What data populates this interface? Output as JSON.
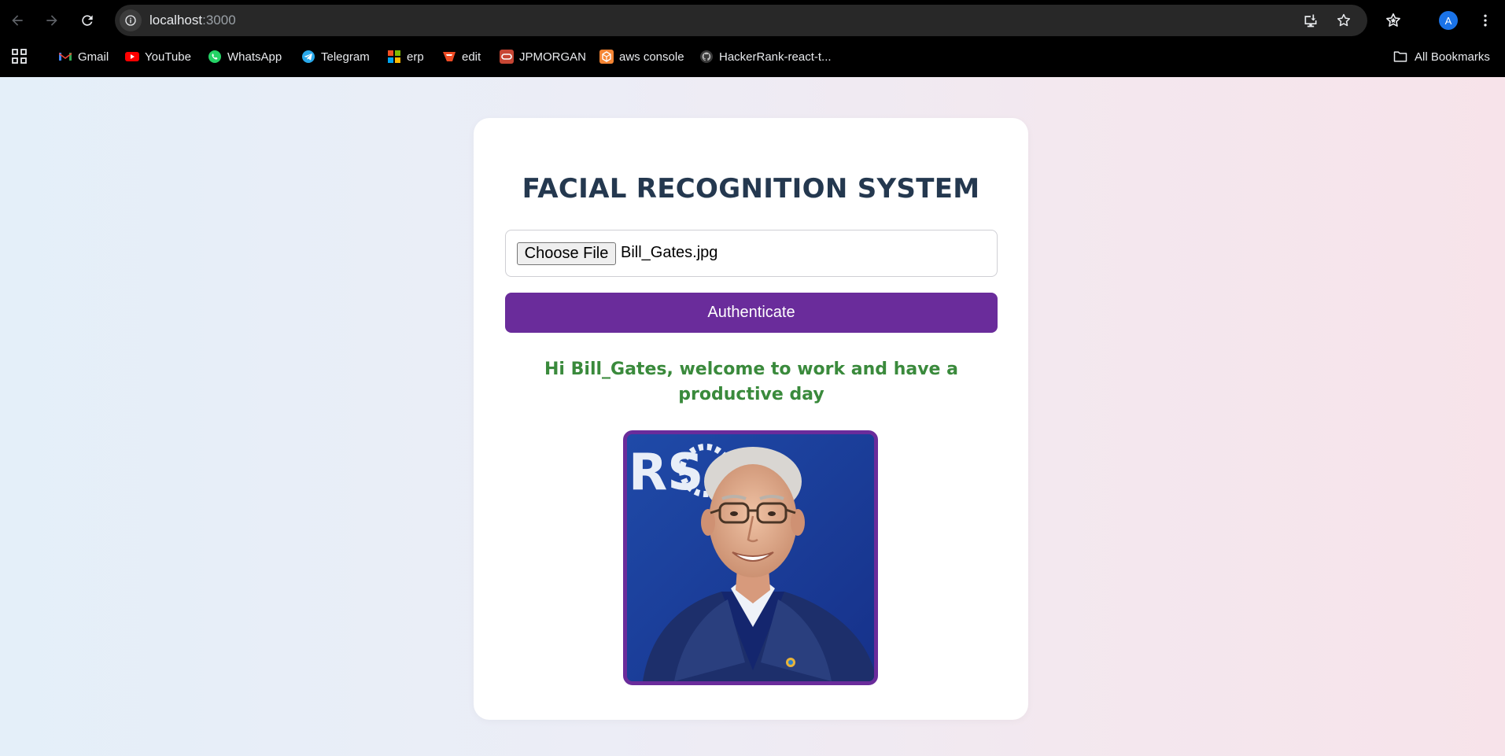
{
  "browser": {
    "url_host": "localhost",
    "url_port": ":3000",
    "profile_initial": "A",
    "bookmarks": [
      {
        "label": "Gmail",
        "icon": "gmail-icon"
      },
      {
        "label": "YouTube",
        "icon": "youtube-icon"
      },
      {
        "label": "WhatsApp",
        "icon": "whatsapp-icon"
      },
      {
        "label": "Telegram",
        "icon": "telegram-icon"
      },
      {
        "label": "erp",
        "icon": "erp-icon"
      },
      {
        "label": "edit",
        "icon": "edit-icon"
      },
      {
        "label": "JPMORGAN",
        "icon": "oracle-icon"
      },
      {
        "label": "aws console",
        "icon": "aws-icon"
      },
      {
        "label": "HackerRank-react-t...",
        "icon": "github-icon"
      }
    ],
    "all_bookmarks_label": "All Bookmarks"
  },
  "app": {
    "title": "FACIAL RECOGNITION SYSTEM",
    "file_input": {
      "button_label": "Choose File",
      "file_name": "Bill_Gates.jpg"
    },
    "authenticate_label": "Authenticate",
    "welcome_message": "Hi Bill_Gates, welcome to work and have a productive day",
    "photo": {
      "background_text": "RS",
      "description": "portrait photo"
    },
    "colors": {
      "title": "#24384f",
      "accent": "#6a2c9b",
      "success": "#3a8a3c"
    }
  }
}
